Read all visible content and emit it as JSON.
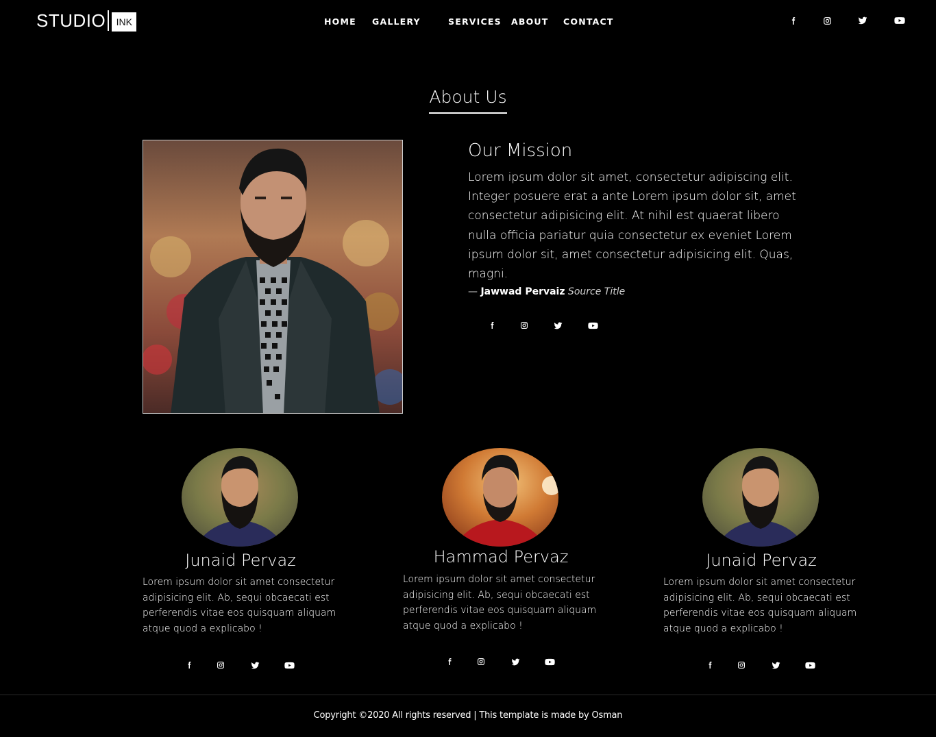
{
  "brand": {
    "name": "STUDIO",
    "badge": "INK"
  },
  "nav": {
    "items": [
      {
        "label": "HOME"
      },
      {
        "label": "GALLERY"
      },
      {
        "label": "SERVICES"
      },
      {
        "label": "ABOUT"
      },
      {
        "label": "CONTACT"
      }
    ]
  },
  "social_icons": [
    "facebook-icon",
    "instagram-icon",
    "twitter-icon",
    "youtube-icon"
  ],
  "about": {
    "title": "About Us",
    "mission_title": "Our Mission",
    "mission_text": "Lorem ipsum dolor sit amet, consectetur adipiscing elit. Integer posuere erat a ante Lorem ipsum dolor sit, amet consectetur adipisicing elit. At nihil est quaerat libero nulla officia pariatur quia consectetur ex eveniet Lorem ipsum dolor sit, amet consectetur adipisicing elit. Quas, magni.",
    "source_dash": "—",
    "source_author": "Jawwad Pervaiz",
    "source_title": "Source Title"
  },
  "team": [
    {
      "name": "Junaid Pervaz",
      "bio": "Lorem ipsum dolor sit amet consectetur adipisicing elit. Ab, sequi obcaecati est perferendis vitae eos quisquam aliquam atque quod a explicabo !"
    },
    {
      "name": "Hammad Pervaz",
      "bio": "Lorem ipsum dolor sit amet consectetur adipisicing elit. Ab, sequi obcaecati est perferendis vitae eos quisquam aliquam atque quod a explicabo !"
    },
    {
      "name": "Junaid Pervaz",
      "bio": "Lorem ipsum dolor sit amet consectetur adipisicing elit. Ab, sequi obcaecati est perferendis vitae eos quisquam aliquam atque quod a explicabo !"
    }
  ],
  "footer": {
    "copyright": "Copyright ©2020 All rights reserved | This template is made by Osman"
  }
}
